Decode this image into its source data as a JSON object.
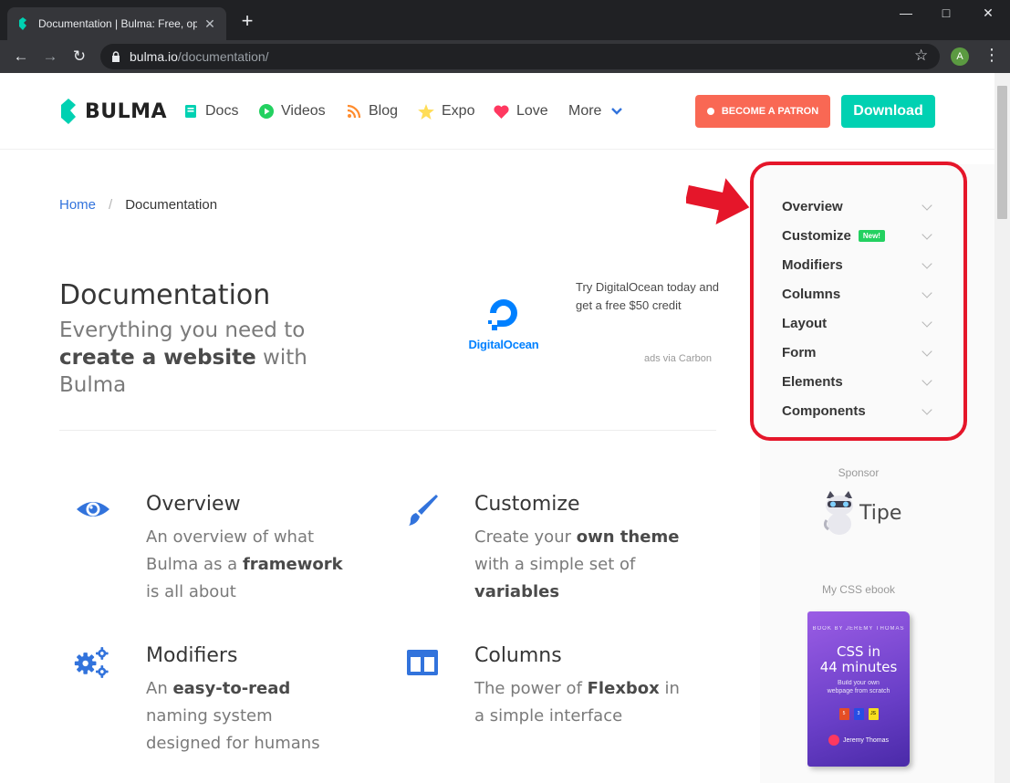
{
  "browser": {
    "tab_title": "Documentation | Bulma: Free, op",
    "url_host": "bulma.io",
    "url_path": "/documentation/",
    "profile_initial": "A"
  },
  "navbar": {
    "brand": "BULMA",
    "items": [
      {
        "label": "Docs",
        "icon": "book-icon"
      },
      {
        "label": "Videos",
        "icon": "play-icon"
      },
      {
        "label": "Blog",
        "icon": "rss-icon"
      },
      {
        "label": "Expo",
        "icon": "star-icon"
      },
      {
        "label": "Love",
        "icon": "heart-icon"
      },
      {
        "label": "More",
        "icon": "chevron-down-icon"
      }
    ],
    "patron_label": "BECOME A PATRON",
    "download_label": "Download",
    "colors": {
      "primary": "#00d1b2",
      "patron": "#f96854",
      "link": "#3273dc"
    }
  },
  "breadcrumb": {
    "home": "Home",
    "separator": "/",
    "current": "Documentation"
  },
  "hero": {
    "title": "Documentation",
    "subtitle_parts": [
      "Everything you need to ",
      "create a website",
      " with Bulma"
    ]
  },
  "ad": {
    "logo_text": "DigitalOcean",
    "text": "Try DigitalOcean today and get a free $50 credit",
    "via": "ads via Carbon"
  },
  "features": [
    {
      "title": "Overview",
      "icon": "eye-icon",
      "desc": [
        "An overview of what Bulma as a ",
        "framework",
        " is all about"
      ]
    },
    {
      "title": "Customize",
      "icon": "paintbrush-icon",
      "desc": [
        "Create your ",
        "own theme",
        " with a simple set of ",
        "variables",
        ""
      ]
    },
    {
      "title": "Modifiers",
      "icon": "cogs-icon",
      "desc": [
        "An ",
        "easy-to-read",
        " naming system designed for humans"
      ]
    },
    {
      "title": "Columns",
      "icon": "columns-icon",
      "desc": [
        "The power of ",
        "Flexbox",
        " in a simple interface"
      ]
    }
  ],
  "sidebar": {
    "menu": [
      {
        "label": "Overview"
      },
      {
        "label": "Customize",
        "tag": "New!"
      },
      {
        "label": "Modifiers"
      },
      {
        "label": "Columns"
      },
      {
        "label": "Layout"
      },
      {
        "label": "Form"
      },
      {
        "label": "Elements"
      },
      {
        "label": "Components"
      }
    ],
    "sponsor_label": "Sponsor",
    "sponsor_name": "Tipe",
    "ebook_label": "My CSS ebook",
    "ebook": {
      "top": "BOOK BY JEREMY THOMAS",
      "title_line1": "CSS in",
      "title_line2": "44 minutes",
      "subtitle": "Build your own webpage from scratch",
      "badges": [
        "5",
        "3",
        "JS"
      ],
      "author": "Jeremy Thomas"
    }
  }
}
